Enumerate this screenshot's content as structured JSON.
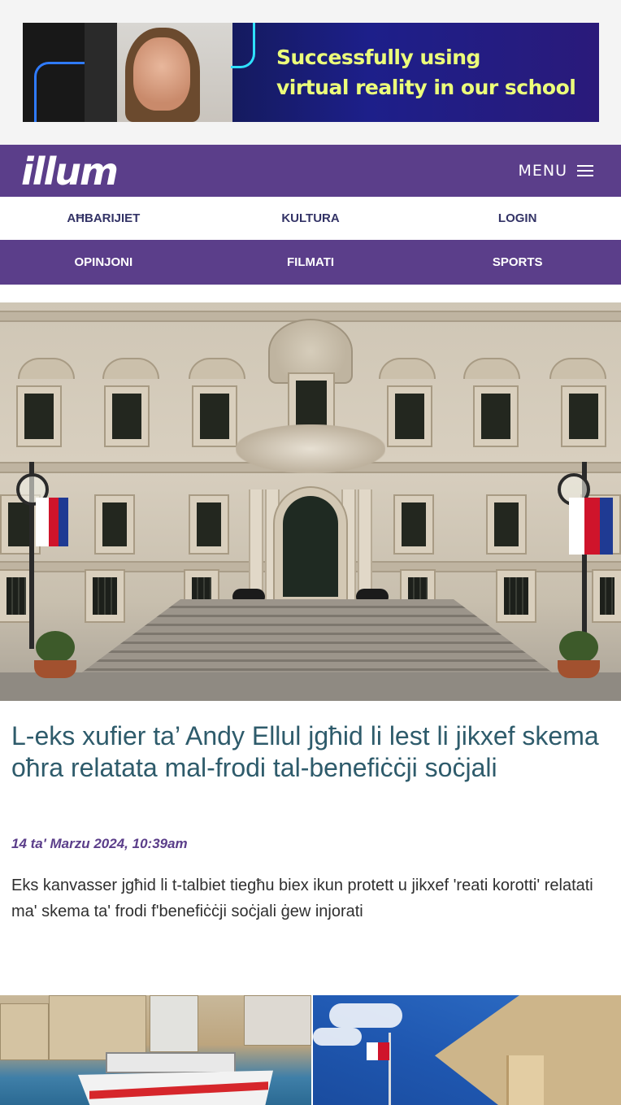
{
  "ad": {
    "line1": "Successfully using",
    "line2": "virtual reality in our school"
  },
  "header": {
    "logo": "illum",
    "menu_label": "MENU"
  },
  "nav": {
    "row1": [
      "AĦBARIJIET",
      "KULTURA",
      "LOGIN"
    ],
    "row2": [
      "OPINJONI",
      "FILMATI",
      "SPORTS"
    ]
  },
  "article": {
    "headline": "L-eks xufier ta’ Andy Ellul jgħid li lest li jikxef skema oħra relatata mal-frodi tal-benefiċċji soċjali",
    "date": "14 ta' Marzu 2024, 10:39am",
    "summary": "Eks kanvasser jgħid li t-talbiet tiegħu biex ikun protett u jikxef 'reati korotti' relatati ma' skema ta' frodi f'benefiċċji soċjali ġew injorati"
  },
  "colors": {
    "brand_purple": "#5b3e8a",
    "headline_teal": "#2e5b6b",
    "ad_text_yellow": "#ecff7a"
  }
}
